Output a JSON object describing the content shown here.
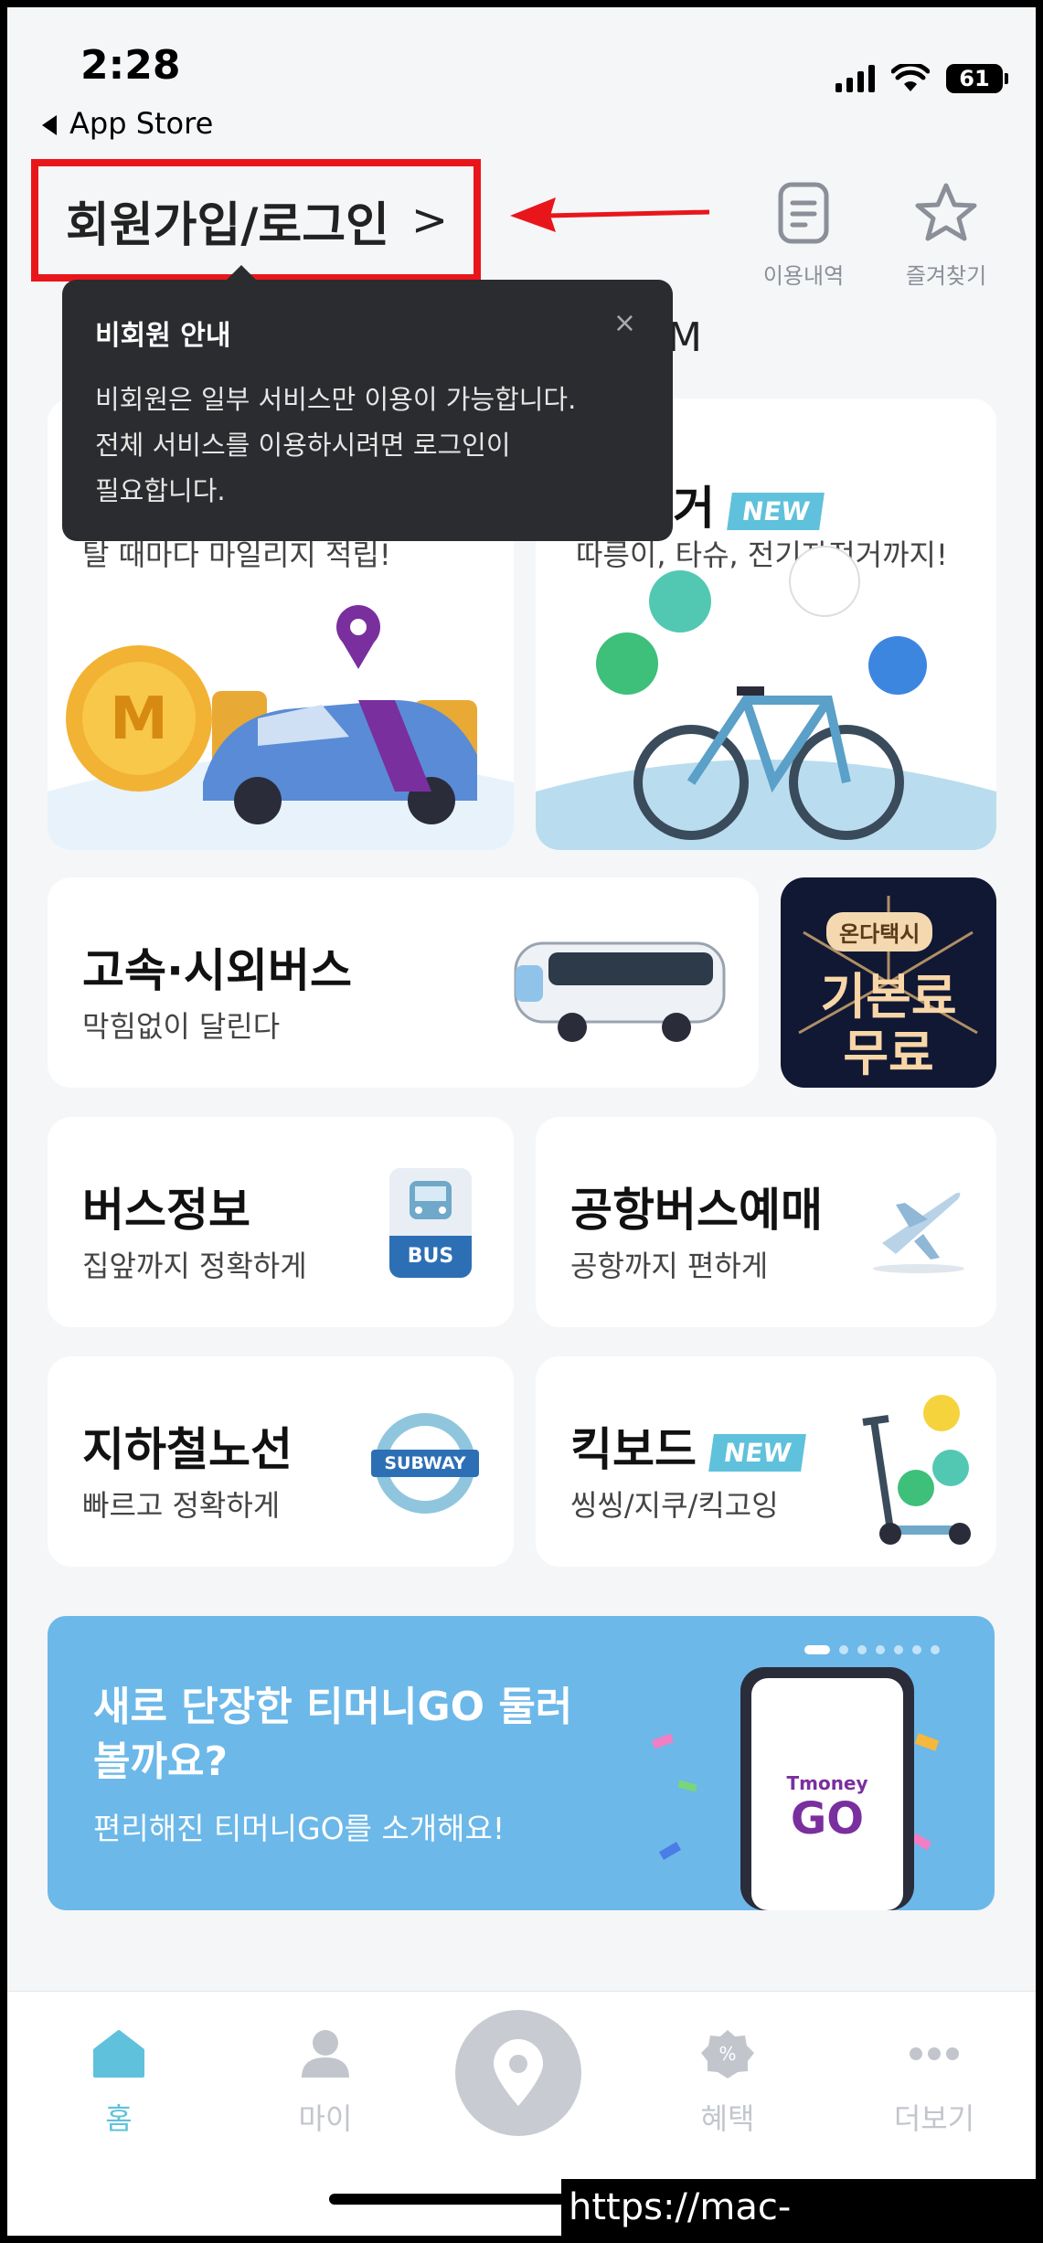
{
  "status_bar": {
    "time": "2:28",
    "back_label": "App Store",
    "battery": "61"
  },
  "header": {
    "login_label": "회원가입/로그인",
    "history_label": "이용내역",
    "favorites_label": "즐겨찾기"
  },
  "tooltip": {
    "title": "비회원 안내",
    "body_line1": "비회원은 일부 서비스만 이용이 가능합니다.",
    "body_line2": "전체 서비스를 이용하시려면 로그인이",
    "body_line3": "필요합니다.",
    "close": "×",
    "peek_text": "M"
  },
  "cards": {
    "mileage_sub": "탈 때마다 마일리지 적립!",
    "bike_title_peek": "거",
    "bike_new": "NEW",
    "bike_sub": "따릉이, 타슈, 전기자전거까지!",
    "express_title": "고속·시외버스",
    "express_sub": "막힘없이 달린다",
    "promo_tag": "온다택시",
    "promo_line1": "기본료",
    "promo_line2": "무료",
    "bus_title": "버스정보",
    "bus_sub": "집앞까지 정확하게",
    "bus_sign": "BUS",
    "airport_title": "공항버스예매",
    "airport_sub": "공항까지 편하게",
    "subway_title": "지하철노선",
    "subway_sub": "빠르고 정확하게",
    "subway_sign": "SUBWAY",
    "kick_title": "킥보드",
    "kick_new": "NEW",
    "kick_sub": "씽씽/지쿠/킥고잉"
  },
  "banner": {
    "title": "새로 단장한 티머니GO 둘러볼까요?",
    "sub": "편리해진 티머니GO를 소개해요!",
    "phone_brand": "Tmoney",
    "phone_go": "GO",
    "page_count": 7,
    "active_page": 1
  },
  "bottom_nav": {
    "home": "홈",
    "my": "마이",
    "benefits": "혜택",
    "more": "더보기"
  },
  "watermark": "https://mac-os.tistory.com",
  "colors": {
    "accent": "#5fc1db",
    "highlight_red": "#e8161b",
    "banner_bg": "#6cb8e9"
  }
}
